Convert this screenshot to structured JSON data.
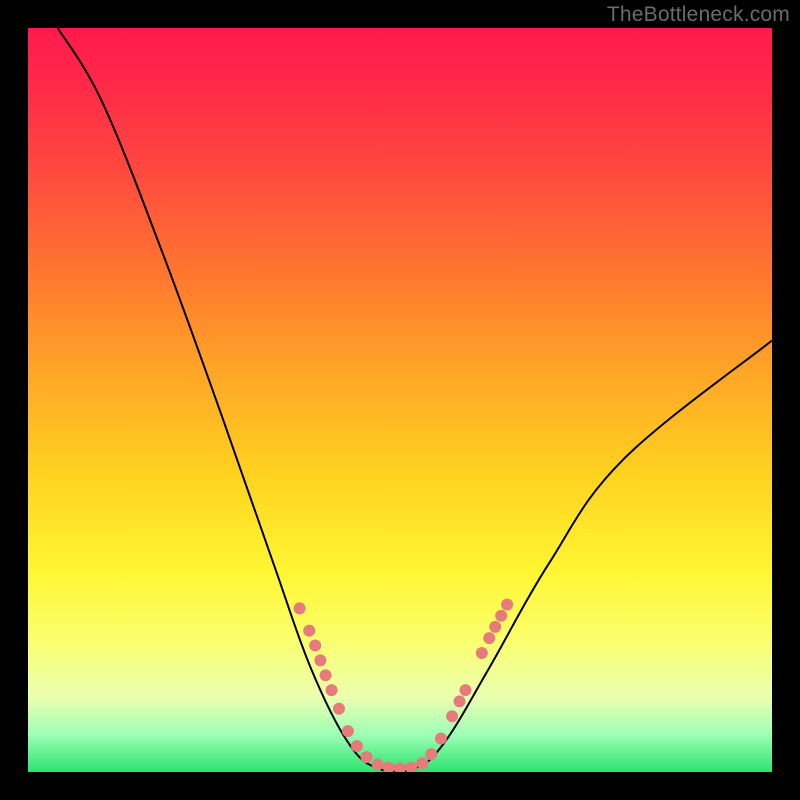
{
  "watermark": "TheBottleneck.com",
  "chart_data": {
    "type": "line",
    "title": "",
    "xlabel": "",
    "ylabel": "",
    "ylim": [
      0,
      100
    ],
    "xlim": [
      0,
      100
    ],
    "curve": {
      "name": "bottleneck-curve",
      "points": [
        {
          "x": 4,
          "y": 100
        },
        {
          "x": 10,
          "y": 90
        },
        {
          "x": 18,
          "y": 70
        },
        {
          "x": 26,
          "y": 48
        },
        {
          "x": 33,
          "y": 28
        },
        {
          "x": 38,
          "y": 14
        },
        {
          "x": 43,
          "y": 4
        },
        {
          "x": 47,
          "y": 0.5
        },
        {
          "x": 52,
          "y": 0.5
        },
        {
          "x": 56,
          "y": 4
        },
        {
          "x": 62,
          "y": 14
        },
        {
          "x": 70,
          "y": 28
        },
        {
          "x": 80,
          "y": 42
        },
        {
          "x": 100,
          "y": 58
        }
      ]
    },
    "markers": [
      {
        "x": 36.5,
        "y": 22
      },
      {
        "x": 37.8,
        "y": 19
      },
      {
        "x": 38.6,
        "y": 17
      },
      {
        "x": 39.3,
        "y": 15
      },
      {
        "x": 40.0,
        "y": 13
      },
      {
        "x": 40.8,
        "y": 11
      },
      {
        "x": 41.8,
        "y": 8.5
      },
      {
        "x": 43.0,
        "y": 5.5
      },
      {
        "x": 44.2,
        "y": 3.5
      },
      {
        "x": 45.5,
        "y": 2.0
      },
      {
        "x": 47.0,
        "y": 1.0
      },
      {
        "x": 48.5,
        "y": 0.6
      },
      {
        "x": 50.0,
        "y": 0.5
      },
      {
        "x": 51.5,
        "y": 0.6
      },
      {
        "x": 53.0,
        "y": 1.2
      },
      {
        "x": 54.2,
        "y": 2.4
      },
      {
        "x": 55.5,
        "y": 4.5
      },
      {
        "x": 57.0,
        "y": 7.5
      },
      {
        "x": 58.0,
        "y": 9.5
      },
      {
        "x": 58.8,
        "y": 11
      },
      {
        "x": 61.0,
        "y": 16
      },
      {
        "x": 62.0,
        "y": 18
      },
      {
        "x": 62.8,
        "y": 19.5
      },
      {
        "x": 63.6,
        "y": 21
      },
      {
        "x": 64.4,
        "y": 22.5
      }
    ],
    "marker_style": {
      "fill": "#e77b7b",
      "radius": 6
    },
    "line_style": {
      "stroke": "#000000",
      "width": 2
    }
  }
}
